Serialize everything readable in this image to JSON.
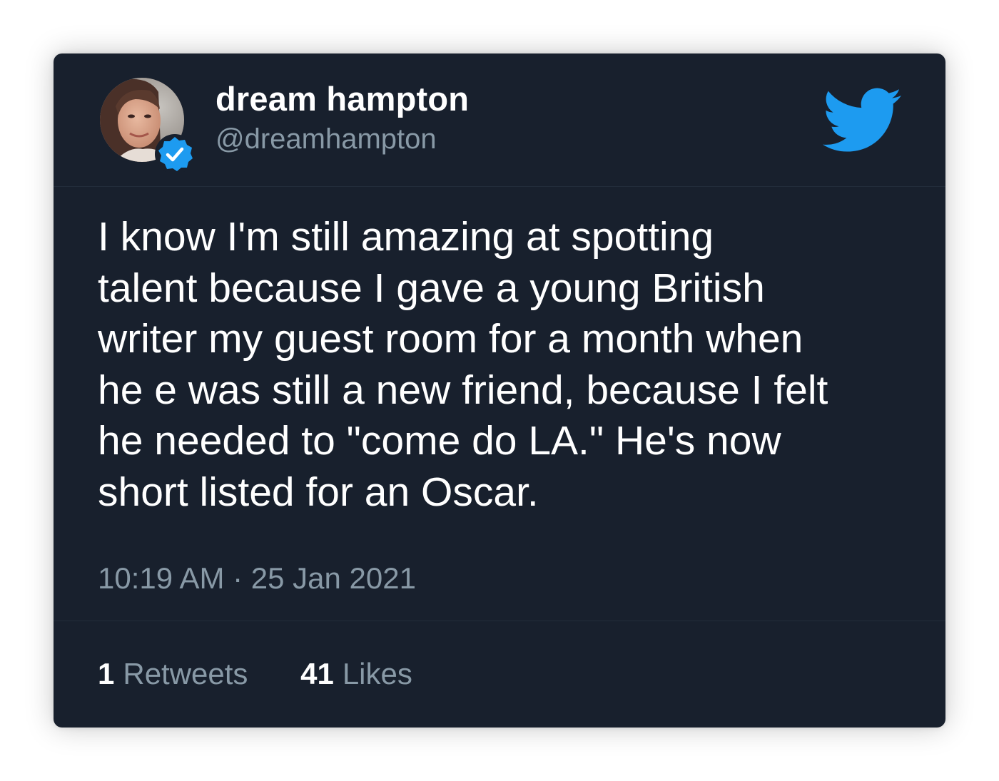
{
  "author": {
    "display_name": "dream hampton",
    "handle": "@dreamhampton",
    "avatar": "profile-photo",
    "verified_icon": "verified-badge-icon"
  },
  "brand_icon": "twitter-bird-icon",
  "tweet": {
    "lines": [
      "I know I'm still amazing at spotting",
      "talent because I gave a young British",
      "writer my guest room for a month when",
      "he e was still a new friend, because I felt",
      "he needed to \"come do LA.\" He's now",
      "short listed for an Oscar."
    ],
    "timestamp": "10:19 AM · 25 Jan 2021"
  },
  "stats": {
    "retweets_count": "1",
    "retweets_label": "Retweets",
    "likes_count": "41",
    "likes_label": "Likes"
  },
  "colors": {
    "card_background": "#18202d",
    "text_primary": "#ffffff",
    "text_secondary": "#8899a6",
    "twitter_blue": "#1d9bf0",
    "divider": "#222c3a"
  }
}
